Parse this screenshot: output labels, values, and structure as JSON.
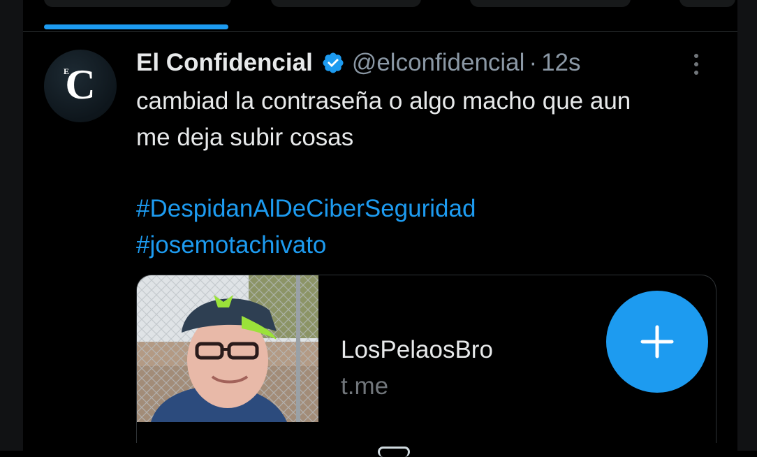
{
  "colors": {
    "background": "#000000",
    "text": "#e7e9ea",
    "muted": "#71767b",
    "accent": "#1d9bf0",
    "border": "#2f3336"
  },
  "tweet": {
    "author": {
      "display_name": "El Confidencial",
      "handle": "@elconfidencial",
      "verified": true,
      "avatar_letter": "C",
      "avatar_small_letter": "E"
    },
    "separator": "·",
    "timestamp": "12s",
    "text_lines": [
      "cambiad la contraseña o algo macho que aun",
      "me deja subir cosas"
    ],
    "hashtags": [
      "#DespidanAlDeCiberSeguridad",
      "#josemotachivato"
    ],
    "card": {
      "title": "LosPelaosBro",
      "domain": "t.me"
    }
  },
  "icons": {
    "verified": "verified-badge-icon",
    "more": "more-vertical-icon",
    "compose": "plus-icon"
  }
}
